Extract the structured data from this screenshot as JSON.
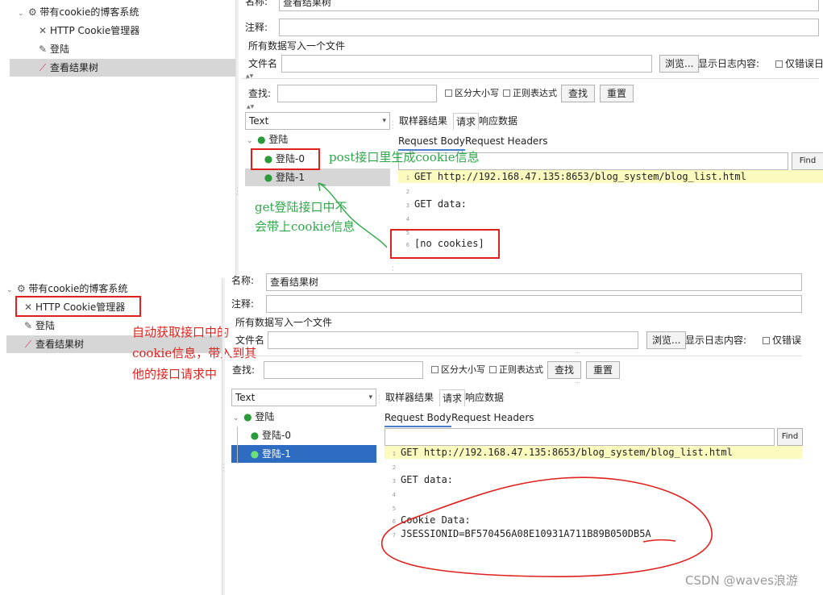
{
  "top": {
    "tree": [
      {
        "label": "带有cookie的博客系统",
        "icon": "gear-icon"
      },
      {
        "label": "HTTP Cookie管理器",
        "icon": "wrench-icon"
      },
      {
        "label": "登陆",
        "icon": "pencil-icon"
      },
      {
        "label": "查看结果树",
        "icon": "chart-icon"
      }
    ],
    "name_label": "名称:",
    "name_value": "查看结果树",
    "comment_label": "注释:",
    "write_all": "所有数据写入一个文件",
    "filename_label": "文件名",
    "browse": "浏览...",
    "log_content": "显示日志内容:",
    "errors_only": "仅错误日",
    "search_label": "查找:",
    "case_sensitive": "区分大小写",
    "regex": "正则表达式",
    "find_btn": "查找",
    "reset_btn": "重置",
    "renderer": "Text",
    "results_tree": [
      "登陆",
      "登陆-0",
      "登陆-1"
    ],
    "tabs": [
      "取样器结果",
      "请求",
      "响应数据"
    ],
    "subtabs": [
      "Request Body",
      "Request Headers"
    ],
    "find_small": "Find",
    "code": [
      {
        "n": "1",
        "text": "GET http://192.168.47.135:8653/blog_system/blog_list.html"
      },
      {
        "n": "2",
        "text": ""
      },
      {
        "n": "3",
        "text": "GET data:"
      },
      {
        "n": "4",
        "text": ""
      },
      {
        "n": "5",
        "text": ""
      },
      {
        "n": "6",
        "text": "[no cookies]"
      }
    ]
  },
  "bottom": {
    "tree": [
      {
        "label": "带有cookie的博客系统",
        "icon": "gear-icon"
      },
      {
        "label": "HTTP Cookie管理器",
        "icon": "wrench-icon"
      },
      {
        "label": "登陆",
        "icon": "pencil-icon"
      },
      {
        "label": "查看结果树",
        "icon": "chart-icon"
      }
    ],
    "name_label": "名称:",
    "name_value": "查看结果树",
    "comment_label": "注释:",
    "write_all": "所有数据写入一个文件",
    "filename_label": "文件名",
    "browse": "浏览...",
    "log_content": "显示日志内容:",
    "errors_only": "仅错误",
    "search_label": "查找:",
    "case_sensitive": "区分大小写",
    "regex": "正则表达式",
    "find_btn": "查找",
    "reset_btn": "重置",
    "renderer": "Text",
    "results_tree": [
      "登陆",
      "登陆-0",
      "登陆-1"
    ],
    "tabs": [
      "取样器结果",
      "请求",
      "响应数据"
    ],
    "subtabs": [
      "Request Body",
      "Request Headers"
    ],
    "find_small": "Find",
    "code": [
      {
        "n": "1",
        "text": "GET http://192.168.47.135:8653/blog_system/blog_list.html"
      },
      {
        "n": "2",
        "text": ""
      },
      {
        "n": "3",
        "text": "GET data:"
      },
      {
        "n": "4",
        "text": ""
      },
      {
        "n": "5",
        "text": ""
      },
      {
        "n": "6",
        "text": "Cookie Data:"
      },
      {
        "n": "7",
        "text": "JSESSIONID=BF570456A08E10931A711B89B050DB5A"
      }
    ]
  },
  "annotations": {
    "green_1": "post接口里生成cookie信息",
    "green_2a": "get登陆接口中不",
    "green_2b": "会带上cookie信息",
    "red_1": "自动获取接口中的",
    "red_2": "cookie信息，带入到其",
    "red_3": "他的接口请求中"
  },
  "watermark": "CSDN @waves浪游",
  "colors": {
    "annotation_red": "#e0201c",
    "annotation_green": "#2ea84a",
    "selection_blue": "#2d6cc0",
    "highlight_yellow": "#fbfbc0"
  }
}
